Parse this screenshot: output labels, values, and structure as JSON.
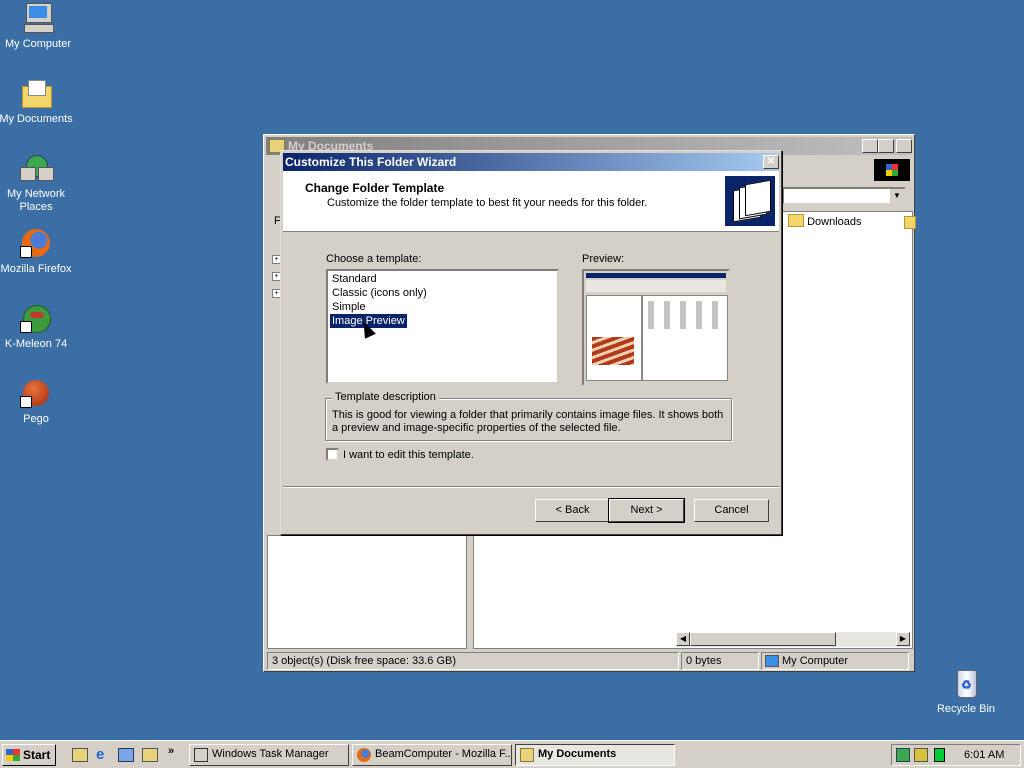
{
  "desktop": {
    "icons": [
      {
        "label": "My Computer"
      },
      {
        "label": "My Documents"
      },
      {
        "label": "My Network Places"
      },
      {
        "label": "Mozilla Firefox"
      },
      {
        "label": "K-Meleon 74"
      },
      {
        "label": "Pego"
      },
      {
        "label": "Recycle Bin"
      }
    ]
  },
  "explorer": {
    "title": "My Documents",
    "left_pane_letter": "F",
    "folder": "Downloads",
    "status": {
      "objects": "3 object(s) (Disk free space: 33.6 GB)",
      "size": "0 bytes",
      "zone": "My Computer"
    }
  },
  "wizard": {
    "title": "Customize This Folder Wizard",
    "header_title": "Change Folder Template",
    "header_subtitle": "Customize the folder template to best fit your needs for this folder.",
    "choose_label": "Choose a template:",
    "templates": [
      "Standard",
      "Classic (icons only)",
      "Simple",
      "Image Preview"
    ],
    "selected_template": "Image Preview",
    "preview_label": "Preview:",
    "description_label": "Template description",
    "description": "This is good for viewing a folder that primarily contains image files. It shows both a preview and image-specific properties of the selected file.",
    "edit_checkbox": "I want to edit this template.",
    "buttons": {
      "back": "< Back",
      "next": "Next >",
      "cancel": "Cancel"
    }
  },
  "taskbar": {
    "start": "Start",
    "tasks": [
      "Windows Task Manager",
      "BeamComputer - Mozilla F...",
      "My Documents"
    ],
    "clock": "6:01 AM"
  },
  "colors": {
    "desktop": "#3a6ea5",
    "title_active": "#0a246a",
    "selection": "#0a246a"
  }
}
